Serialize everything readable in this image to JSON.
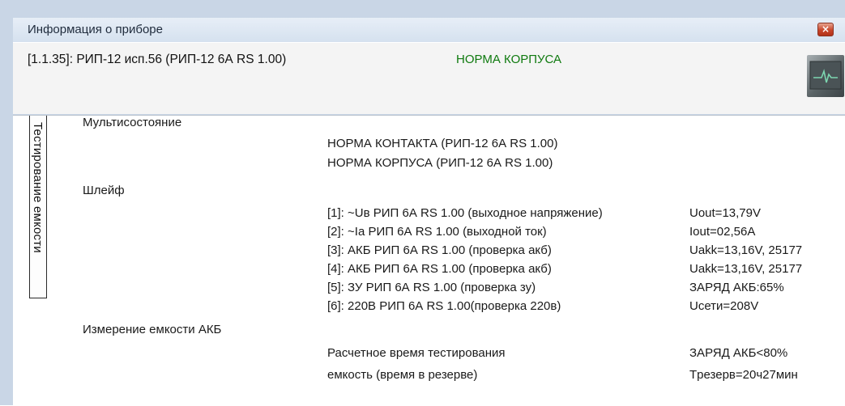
{
  "window": {
    "title": "Информация о приборе",
    "close_glyph": "×"
  },
  "header": {
    "device": "[1.1.35]: РИП-12 исп.56 (РИП-12 6А RS 1.00)",
    "case_status": "НОРМА КОРПУСА",
    "icon": "monitor-pulse-icon"
  },
  "tab": {
    "label": "Тестирование емкости"
  },
  "sections": {
    "multistate": {
      "label": "Мультисостояние",
      "lines": [
        "НОРМА КОНТАКТА (РИП-12 6А RS 1.00)",
        "НОРМА КОРПУСА   (РИП-12 6А RS 1.00)"
      ]
    },
    "loop": {
      "label": "Шлейф",
      "rows": [
        {
          "name": "[1]: ~Uв РИП 6А RS 1.00 (выходное напряжение)",
          "value": "Uout=13,79V"
        },
        {
          "name": "[2]: ~Iа  РИП 6А RS 1.00 (выходной ток)",
          "value": "Iout=02,56A"
        },
        {
          "name": "[3]: АКБ РИП 6А RS 1.00 (проверка акб)",
          "value": "Uakk=13,16V,  25177"
        },
        {
          "name": "[4]: АКБ РИП 6А RS 1.00 (проверка акб)",
          "value": "Uakk=13,16V,  25177"
        },
        {
          "name": "[5]: ЗУ  РИП 6А RS 1.00  (проверка зу)",
          "value": "ЗАРЯД АКБ:65%"
        },
        {
          "name": "[6]: 220В РИП 6А RS 1.00(проверка 220в)",
          "value": "Uсети=208V"
        }
      ]
    },
    "capacity": {
      "label": "Измерение емкости АКБ",
      "line1": "Расчетное время тестирования",
      "line2": "емкость (время в резерве)",
      "value1": "ЗАРЯД АКБ<80%",
      "value2": "Tрезерв=20ч27мин"
    }
  },
  "colors": {
    "frame": "#c9d6e6",
    "status_green": "#0f7a0f",
    "close_red": "#c8452a"
  }
}
